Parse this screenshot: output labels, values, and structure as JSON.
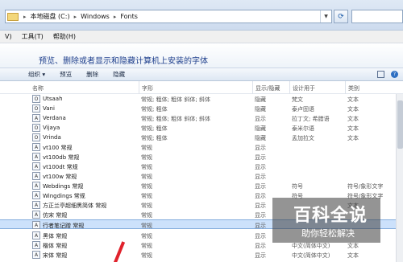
{
  "address": {
    "crumbs": [
      "本地磁盘 (C:)",
      "Windows",
      "Fonts"
    ]
  },
  "menu": {
    "items": [
      "V)",
      "工具(T)",
      "帮助(H)"
    ]
  },
  "header": {
    "title": "预览、删除或者显示和隐藏计算机上安装的字体"
  },
  "toolbar": {
    "buttons": [
      "组织 ▾",
      "预览",
      "删除",
      "隐藏"
    ]
  },
  "columns": {
    "name": "名称",
    "style": "字形",
    "show": "显示/隐藏",
    "design": "设计用于",
    "category": "类别"
  },
  "fonts": [
    {
      "name": "Utsaah",
      "style": "常规; 粗体; 粗体 斜体; 斜体",
      "show": "隐藏",
      "design": "梵文",
      "cat": "文本"
    },
    {
      "name": "Vani",
      "style": "常规; 粗体",
      "show": "隐藏",
      "design": "泰卢固语",
      "cat": "文本"
    },
    {
      "name": "Verdana",
      "style": "常规; 粗体; 粗体 斜体; 斜体",
      "show": "显示",
      "design": "拉丁文; 希腊语",
      "cat": "文本"
    },
    {
      "name": "Vijaya",
      "style": "常规; 粗体",
      "show": "隐藏",
      "design": "泰米尔语",
      "cat": "文本"
    },
    {
      "name": "Vrinda",
      "style": "常规; 粗体",
      "show": "隐藏",
      "design": "孟加拉文",
      "cat": "文本"
    },
    {
      "name": "vt100 常规",
      "style": "常规",
      "show": "显示",
      "design": "",
      "cat": ""
    },
    {
      "name": "vt100db 常规",
      "style": "常规",
      "show": "显示",
      "design": "",
      "cat": ""
    },
    {
      "name": "vt100dt 常规",
      "style": "常规",
      "show": "显示",
      "design": "",
      "cat": ""
    },
    {
      "name": "vt100w 常规",
      "style": "常规",
      "show": "显示",
      "design": "",
      "cat": ""
    },
    {
      "name": "Webdings 常规",
      "style": "常规",
      "show": "显示",
      "design": "符号",
      "cat": "符号/象形文字"
    },
    {
      "name": "Wingdings 常规",
      "style": "常规",
      "show": "显示",
      "design": "符号",
      "cat": "符号/象形文字"
    },
    {
      "name": "方正兰亭超细黑简体 常规",
      "style": "常规",
      "show": "显示",
      "design": "",
      "cat": "文本"
    },
    {
      "name": "仿宋 常规",
      "style": "常规",
      "show": "显示",
      "design": "",
      "cat": ""
    },
    {
      "name": "行者笔记蹭 常规",
      "style": "常规",
      "show": "显示",
      "design": "",
      "cat": ""
    },
    {
      "name": "黑体 常规",
      "style": "常规",
      "show": "显示",
      "design": "",
      "cat": ""
    },
    {
      "name": "楷体 常规",
      "style": "常规",
      "show": "显示",
      "design": "中文(简体中文)",
      "cat": "文本"
    },
    {
      "name": "宋体 常规",
      "style": "常规",
      "show": "显示",
      "design": "中文(简体中文)",
      "cat": "文本"
    }
  ],
  "watermark": {
    "big": "百科全说",
    "small": "助你轻松解决"
  }
}
